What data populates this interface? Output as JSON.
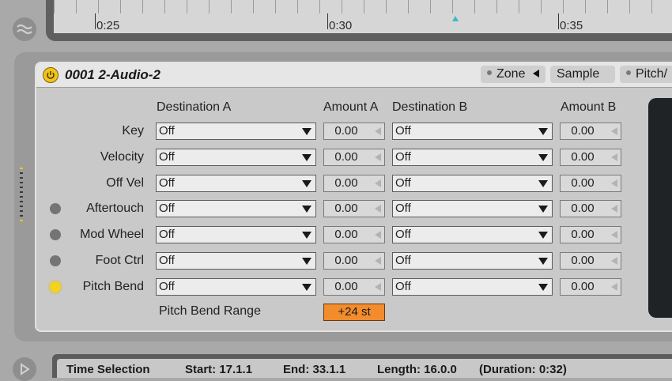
{
  "timeline": {
    "ticks": [
      {
        "label": "0:25"
      },
      {
        "label": "0:30"
      },
      {
        "label": "0:35"
      }
    ]
  },
  "device": {
    "title": "0001 2-Audio-2",
    "tabs": [
      "Zone",
      "Sample",
      "Pitch/"
    ],
    "columns": {
      "dest_a": "Destination A",
      "amount_a": "Amount A",
      "dest_b": "Destination B",
      "amount_b": "Amount B"
    },
    "rows": [
      {
        "label": "Key",
        "led": "none",
        "dest_a": "Off",
        "amount_a": "0.00",
        "dest_b": "Off",
        "amount_b": "0.00"
      },
      {
        "label": "Velocity",
        "led": "none",
        "dest_a": "Off",
        "amount_a": "0.00",
        "dest_b": "Off",
        "amount_b": "0.00"
      },
      {
        "label": "Off Vel",
        "led": "none",
        "dest_a": "Off",
        "amount_a": "0.00",
        "dest_b": "Off",
        "amount_b": "0.00"
      },
      {
        "label": "Aftertouch",
        "led": "off",
        "dest_a": "Off",
        "amount_a": "0.00",
        "dest_b": "Off",
        "amount_b": "0.00"
      },
      {
        "label": "Mod Wheel",
        "led": "off",
        "dest_a": "Off",
        "amount_a": "0.00",
        "dest_b": "Off",
        "amount_b": "0.00"
      },
      {
        "label": "Foot Ctrl",
        "led": "off",
        "dest_a": "Off",
        "amount_a": "0.00",
        "dest_b": "Off",
        "amount_b": "0.00"
      },
      {
        "label": "Pitch Bend",
        "led": "on",
        "dest_a": "Off",
        "amount_a": "0.00",
        "dest_b": "Off",
        "amount_b": "0.00"
      }
    ],
    "pitch_bend_range": {
      "label": "Pitch Bend Range",
      "value": "+24 st"
    }
  },
  "status": {
    "title": "Time Selection",
    "start": "Start: 17.1.1",
    "end": "End: 33.1.1",
    "length": "Length: 16.0.0",
    "duration": "(Duration: 0:32)"
  },
  "colors": {
    "accent_orange": "#f28c2d",
    "led_on": "#f5d21c",
    "led_off": "#747474",
    "power_yellow": "#f2c31a"
  },
  "icons": {
    "side_top": "wave-icon",
    "side_bottom": "play-icon",
    "power": "power-icon",
    "zone_arrow": "triangle-left-icon"
  }
}
